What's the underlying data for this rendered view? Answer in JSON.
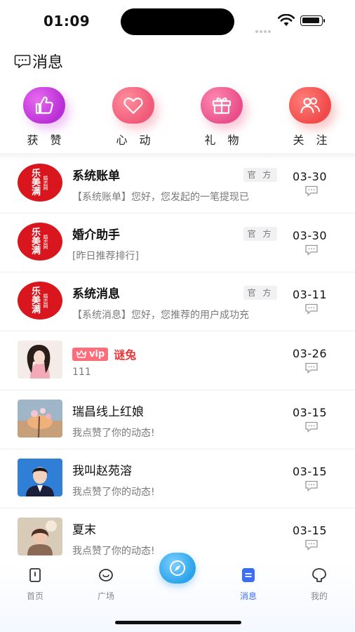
{
  "status_bar": {
    "time": "01:09"
  },
  "header": {
    "title": "消息",
    "icon": "chat-bubble-icon"
  },
  "categories": [
    {
      "label": "获 赞",
      "icon": "thumbs-up-icon",
      "color": "#c63ddd"
    },
    {
      "label": "心 动",
      "icon": "heart-icon",
      "color": "#f25d7a"
    },
    {
      "label": "礼 物",
      "icon": "gift-icon",
      "color": "#ea5590"
    },
    {
      "label": "关 注",
      "icon": "users-icon",
      "color": "#f24e4e"
    }
  ],
  "messages": [
    {
      "name": "系统账单",
      "tag": "官 方",
      "preview": "【系统账单】您好，您发起的一笔提现已",
      "date": "03-30",
      "avatar": "brand-logo",
      "logo_text": "乐美满",
      "logo_sub": "婚恋网"
    },
    {
      "name": "婚介助手",
      "tag": "官 方",
      "preview": "[昨日推荐排行]",
      "date": "03-30",
      "avatar": "brand-logo",
      "logo_text": "乐美满",
      "logo_sub": "婚恋网"
    },
    {
      "name": "系统消息",
      "tag": "官 方",
      "preview": "【系统消息】您好，您推荐的用户成功充",
      "date": "03-11",
      "avatar": "brand-logo",
      "logo_text": "乐美满",
      "logo_sub": "婚恋网"
    },
    {
      "name": "谜兔",
      "vip": "vip",
      "preview": "111",
      "date": "03-26",
      "avatar": "user-photo"
    },
    {
      "name": "瑞昌线上红娘",
      "preview": "我点赞了你的动态!",
      "date": "03-15",
      "avatar": "user-photo"
    },
    {
      "name": "我叫赵苑溶",
      "preview": "我点赞了你的动态!",
      "date": "03-15",
      "avatar": "user-photo"
    },
    {
      "name": "夏末",
      "preview": "我点赞了你的动态!",
      "date": "03-15",
      "avatar": "user-photo"
    }
  ],
  "tab_bar": {
    "tabs": [
      {
        "label": "首页",
        "icon": "home-icon"
      },
      {
        "label": "广场",
        "icon": "plaza-icon"
      },
      {
        "label": "消息",
        "icon": "message-icon",
        "active": true
      },
      {
        "label": "我的",
        "icon": "profile-icon"
      }
    ],
    "center_icon": "compass-icon",
    "active_color": "#3b6df6"
  }
}
